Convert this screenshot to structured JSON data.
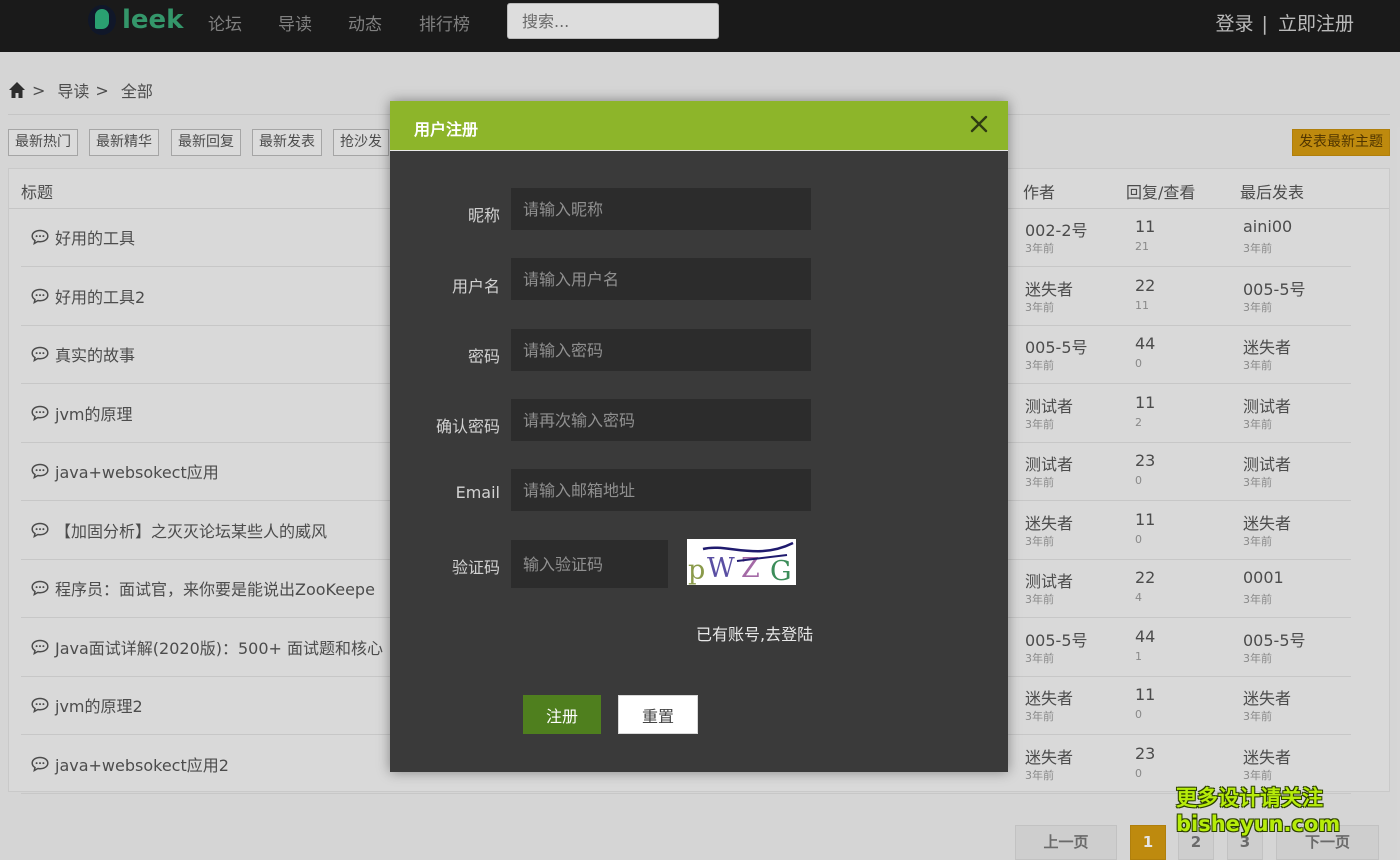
{
  "header": {
    "logo_text": "leek",
    "nav": [
      "论坛",
      "导读",
      "动态",
      "排行榜"
    ],
    "search_placeholder": "搜索...",
    "login": "登录",
    "separator": "|",
    "register": "立即注册"
  },
  "breadcrumb": {
    "sep": ">",
    "items": [
      "导读",
      "全部"
    ]
  },
  "filters": [
    "最新热门",
    "最新精华",
    "最新回复",
    "最新发表",
    "抢沙发"
  ],
  "publish_button": "发表最新主题",
  "table": {
    "headers": {
      "title": "标题",
      "author": "作者",
      "reply_view": "回复/查看",
      "last_post": "最后发表"
    },
    "rows": [
      {
        "title": "好用的工具",
        "author": "002-2号",
        "author_time": "3年前",
        "replies": "11",
        "views": "21",
        "last_user": "aini00",
        "last_time": "3年前"
      },
      {
        "title": "好用的工具2",
        "author": "迷失者",
        "author_time": "3年前",
        "replies": "22",
        "views": "11",
        "last_user": "005-5号",
        "last_time": "3年前"
      },
      {
        "title": "真实的故事",
        "author": "005-5号",
        "author_time": "3年前",
        "replies": "44",
        "views": "0",
        "last_user": "迷失者",
        "last_time": "3年前"
      },
      {
        "title": "jvm的原理",
        "author": "测试者",
        "author_time": "3年前",
        "replies": "11",
        "views": "2",
        "last_user": "测试者",
        "last_time": "3年前"
      },
      {
        "title": "java+websokect应用",
        "author": "测试者",
        "author_time": "3年前",
        "replies": "23",
        "views": "0",
        "last_user": "测试者",
        "last_time": "3年前"
      },
      {
        "title": "【加固分析】之灭灭论坛某些人的威风",
        "author": "迷失者",
        "author_time": "3年前",
        "replies": "11",
        "views": "0",
        "last_user": "迷失者",
        "last_time": "3年前"
      },
      {
        "title": "程序员：面试官，来你要是能说出ZooKeepe",
        "author": "测试者",
        "author_time": "3年前",
        "replies": "22",
        "views": "4",
        "last_user": "0001",
        "last_time": "3年前"
      },
      {
        "title": "Java面试详解(2020版)：500+ 面试题和核心",
        "author": "005-5号",
        "author_time": "3年前",
        "replies": "44",
        "views": "1",
        "last_user": "005-5号",
        "last_time": "3年前"
      },
      {
        "title": "jvm的原理2",
        "author": "迷失者",
        "author_time": "3年前",
        "replies": "11",
        "views": "0",
        "last_user": "迷失者",
        "last_time": "3年前"
      },
      {
        "title": "java+websokect应用2",
        "author": "迷失者",
        "author_time": "3年前",
        "replies": "23",
        "views": "0",
        "last_user": "迷失者",
        "last_time": "3年前"
      }
    ]
  },
  "pagination": {
    "prev": "上一页",
    "pages": [
      "1",
      "2",
      "3"
    ],
    "current": "1",
    "next": "下一页"
  },
  "modal": {
    "title": "用户注册",
    "fields": [
      {
        "label": "昵称",
        "placeholder": "请输入昵称"
      },
      {
        "label": "用户名",
        "placeholder": "请输入用户名"
      },
      {
        "label": "密码",
        "placeholder": "请输入密码"
      },
      {
        "label": "确认密码",
        "placeholder": "请再次输入密码"
      },
      {
        "label": "Email",
        "placeholder": "请输入邮箱地址"
      }
    ],
    "captcha": {
      "label": "验证码",
      "placeholder": "输入验证码",
      "image_text": "pWZG"
    },
    "login_link": "已有账号,去登陆",
    "submit": "注册",
    "reset": "重置"
  },
  "watermark": {
    "line1": "更多设计请关注",
    "line2": "bisheyun.com"
  },
  "colors": {
    "accent_green": "#8db52a",
    "submit_green": "#4f7f1e",
    "orange": "#d49a10",
    "modal_bg": "#3a3a3a",
    "topbar_bg": "#1e1e1e"
  }
}
